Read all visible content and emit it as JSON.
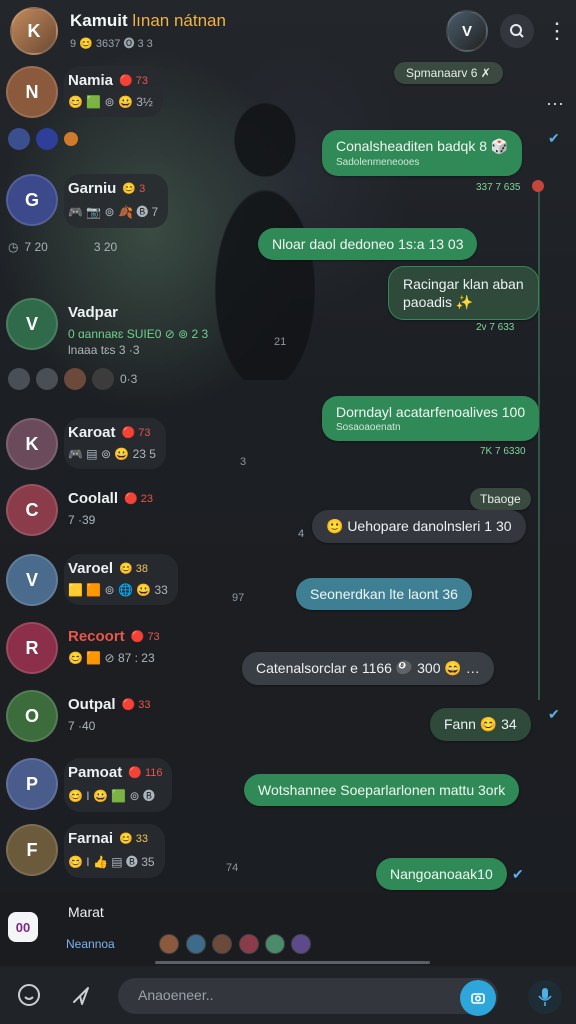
{
  "header": {
    "title": "Kamuit",
    "title_accent": "lınan nátnan",
    "subtitle": "9 😊 3637 🅞 3 3",
    "search_icon": "search-icon",
    "menu_icon": "kebab-icon"
  },
  "contacts": [
    {
      "name": "Namia",
      "badge": "🔴 73",
      "meta": "😊 🟩 ⊚ 😀 3½",
      "tail": "↑",
      "color": "#8b5a3c"
    },
    {
      "name": "Garniu",
      "badge": "😊 3",
      "meta": "🎮 📷 ⊚ 🍂 🅑 7",
      "tail": "",
      "color": "#3c4a8b"
    },
    {
      "name": "Vadpar",
      "badge": "",
      "meta": "0 ɑannaʀɛ SUIE0  ⊘ ⊚ 2 3",
      "meta2": "lnaaa tɛs 3 ·3",
      "tail": "21",
      "color": "#2f6b4a"
    },
    {
      "name": "Karoat",
      "badge": "🔴 73",
      "meta": "🎮 ▤ ⊚ 😀 23 5",
      "tail": "3",
      "color": "#6b4a5c"
    },
    {
      "name": "Coolall",
      "badge": "🔴 23",
      "meta": "7 ·39",
      "tail": "",
      "color": "#8b3c4a"
    },
    {
      "name": "Varoel",
      "badge": "😊 38",
      "meta": "🟨 🟧 ⊚ 🌐 😀 33",
      "tail": "97",
      "color": "#4a6b8b"
    },
    {
      "name": "Recoort",
      "badge": "🔴 73",
      "meta": "😊 🟧 ⊘ 87 : 23",
      "tail": "",
      "color": "#8b2f4a"
    },
    {
      "name": "Outpal",
      "badge": "🔴 33",
      "meta": "7 ·40",
      "tail": "",
      "color": "#3c6b3c"
    },
    {
      "name": "Pamoat",
      "badge": "🔴 116",
      "meta": "😊 I 😀 🟩 ⊚ 🅑",
      "tail": "",
      "color": "#4a5c8b"
    },
    {
      "name": "Farnai",
      "badge": "😊 33",
      "meta": "😊 I 👍 ▤ 🅑 35",
      "tail": "74",
      "color": "#6b5a3c"
    }
  ],
  "status_row": {
    "label": "7 20",
    "extra": "3 20"
  },
  "status_row2": {
    "label": "0·3"
  },
  "bubbles": {
    "top_chip": "Spmanaarv 6 ✗",
    "b1": "Conalsheaditen badqk 8 🎲",
    "b1_sub": "Sadolenmeneooes",
    "b1_time": "337 7 635",
    "b2": "Nloar daol dedoneo 1s:a 13 03",
    "b3_line1": "Racingar klan aban",
    "b3_line2": "paoadis ✨",
    "b3_time": "2v 7 633",
    "b4": "Dorndayl acatarfenoalives 100",
    "b4_sub": "Sosaoaoenatn",
    "b4_time": "7K 7 6330",
    "b5_label": "Tbaoge",
    "b6": "🙂 Uehopare danolnsleri  1 30",
    "b7": "Seonerdkan lte laont 36",
    "b8": "Catenalsorclar e 1166 🎱 300 😄 …",
    "b9": "Fann 😊 34",
    "b10": "Wotshannee Soeparlarlonen mattu 3ork",
    "b11": "Nangoanoaak10"
  },
  "marked": {
    "icon_text": "00",
    "title": "Marat",
    "sub": "Neannoa"
  },
  "inputbar": {
    "placeholder": "Anaoeneer..",
    "emoji_icon": "smiley-icon",
    "attach_icon": "paperclip-icon",
    "send_icon": "camera-icon",
    "mic_icon": "mic-icon"
  },
  "colors": {
    "bubble_green": "#2f8a57",
    "accent_blue": "#2ea6dc",
    "badge_red": "#e9564b"
  }
}
